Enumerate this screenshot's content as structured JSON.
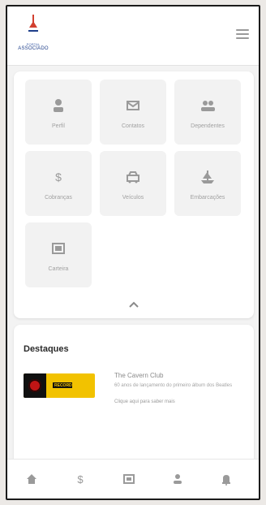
{
  "header": {
    "logo_name": "house-logo",
    "logo_line1": "PORTAL",
    "logo_line2": "ASSOCIADO"
  },
  "menu": {
    "tiles": [
      {
        "label": "Perfil",
        "icon": "person-icon"
      },
      {
        "label": "Contatos",
        "icon": "mail-icon"
      },
      {
        "label": "Dependentes",
        "icon": "people-icon"
      },
      {
        "label": "Cobranças",
        "icon": "dollar-icon"
      },
      {
        "label": "Veículos",
        "icon": "car-icon"
      },
      {
        "label": "Embarcações",
        "icon": "boat-icon"
      },
      {
        "label": "Carteira",
        "icon": "id-card-icon"
      }
    ]
  },
  "highlights": {
    "title": "Destaques",
    "banner_text": "RECORD",
    "news_title": "The Cavern Club",
    "news_desc": "60 anos de lançamento do primeiro álbum dos Beatles",
    "more_label": "Clique aqui para saber mais"
  },
  "bottom_nav": [
    {
      "icon": "home-icon"
    },
    {
      "icon": "dollar-icon"
    },
    {
      "icon": "id-card-icon"
    },
    {
      "icon": "person-icon"
    },
    {
      "icon": "bell-icon"
    }
  ],
  "colors": {
    "accent": "#1e3e8a",
    "tile_bg": "#f2f2f2",
    "icon_gray": "#9a9a9a"
  }
}
